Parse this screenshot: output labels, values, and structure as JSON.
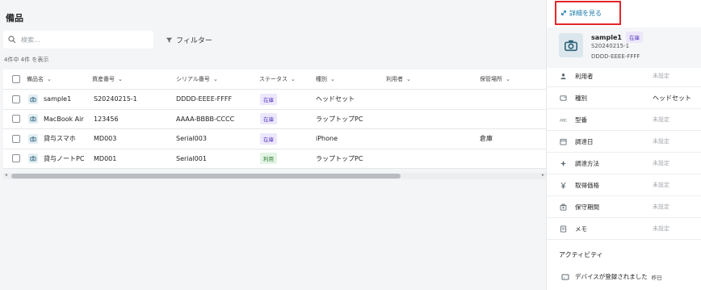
{
  "main": {
    "title": "備品",
    "search_placeholder": "検索...",
    "filter_label": "フィルター",
    "count_text": "4件中 4件 を表示",
    "columns": [
      "備品名",
      "資産番号",
      "シリアル番号",
      "ステータス",
      "種別",
      "利用者",
      "保管場所"
    ],
    "rows": [
      {
        "name": "sample1",
        "asset": "S20240215-1",
        "serial": "DDDD-EEEE-FFFF",
        "status": "在庫",
        "status_kind": "zaiko",
        "type": "ヘッドセット",
        "user": "",
        "location": ""
      },
      {
        "name": "MacBook Air",
        "asset": "123456",
        "serial": "AAAA-BBBB-CCCC",
        "status": "在庫",
        "status_kind": "zaiko",
        "type": "ラップトップPC",
        "user": "",
        "location": ""
      },
      {
        "name": "貸与スマホ",
        "asset": "MD003",
        "serial": "Serial003",
        "status": "在庫",
        "status_kind": "zaiko",
        "type": "iPhone",
        "user": "",
        "location": "倉庫"
      },
      {
        "name": "貸与ノートPC",
        "asset": "MD001",
        "serial": "Serial001",
        "status": "利用",
        "status_kind": "riyo",
        "type": "ラップトップPC",
        "user": "",
        "location": ""
      }
    ]
  },
  "panel": {
    "detail_button": "詳細を見る",
    "name": "sample1",
    "status": "在庫",
    "asset": "S20240215-1",
    "serial": "DDDD-EEEE-FFFF",
    "fields": [
      {
        "icon": "user-icon",
        "label": "利用者",
        "value": "未設定",
        "set": false
      },
      {
        "icon": "device-type-icon",
        "label": "種別",
        "value": "ヘッドセット",
        "set": true
      },
      {
        "icon": "model-icon",
        "label": "型番",
        "value": "未設定",
        "set": false
      },
      {
        "icon": "calendar-icon",
        "label": "調達日",
        "value": "未設定",
        "set": false
      },
      {
        "icon": "procurement-icon",
        "label": "調達方法",
        "value": "未設定",
        "set": false
      },
      {
        "icon": "yen-icon",
        "label": "取得価格",
        "value": "未設定",
        "set": false
      },
      {
        "icon": "warranty-icon",
        "label": "保守期間",
        "value": "未設定",
        "set": false
      },
      {
        "icon": "memo-icon",
        "label": "メモ",
        "value": "未設定",
        "set": false
      }
    ],
    "activity_title": "アクティビティ",
    "activity_item": "デバイスが登録されました",
    "activity_time": "昨日"
  },
  "colors": {
    "accent": "#1a7aa8",
    "highlight_border": "#e3262b",
    "badge_zaiko": "#5b3fc0",
    "badge_riyo": "#2f7d34"
  }
}
